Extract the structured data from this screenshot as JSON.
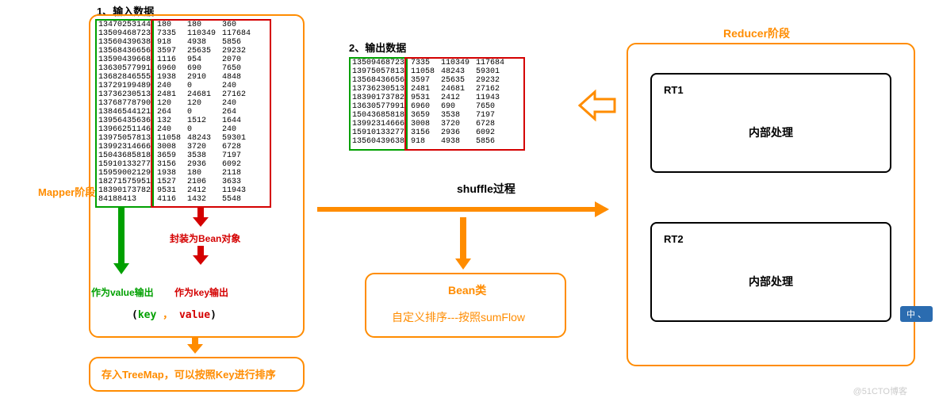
{
  "labels": {
    "input_title": "1、输入数据",
    "output_title": "2、输出数据",
    "mapper": "Mapper阶段",
    "reducer": "Reducer阶段",
    "shuffle": "shuffle过程",
    "bean_wrap": "封装为Bean对象",
    "as_value": "作为value输出",
    "as_key": "作为key输出",
    "bean_class": "Bean类",
    "bean_sort": "自定义排序---按照sumFlow",
    "treemap": "存入TreeMap，可以按照Key进行排序",
    "rt1": "RT1",
    "rt2": "RT2",
    "internal": "内部处理",
    "key": "key",
    "comma": "，",
    "value": "value",
    "ime": "中 、",
    "watermark": "@51CTO博客"
  },
  "input_data": [
    [
      "13470253144",
      "180",
      "180",
      "360"
    ],
    [
      "13509468723",
      "7335",
      "110349",
      "117684"
    ],
    [
      "13560439638",
      "918",
      "4938",
      "5856"
    ],
    [
      "13568436656",
      "3597",
      "25635",
      "29232"
    ],
    [
      "13590439668",
      "1116",
      "954",
      "2070"
    ],
    [
      "13630577991",
      "6960",
      "690",
      "7650"
    ],
    [
      "13682846555",
      "1938",
      "2910",
      "4848"
    ],
    [
      "13729199489",
      "240",
      "0",
      "240"
    ],
    [
      "13736230513",
      "2481",
      "24681",
      "27162"
    ],
    [
      "13768778790",
      "120",
      "120",
      "240"
    ],
    [
      "13846544121",
      "264",
      "0",
      "264"
    ],
    [
      "13956435636",
      "132",
      "1512",
      "1644"
    ],
    [
      "13966251146",
      "240",
      "0",
      "240"
    ],
    [
      "13975057813",
      "11058",
      "48243",
      "59301"
    ],
    [
      "13992314666",
      "3008",
      "3720",
      "6728"
    ],
    [
      "15043685818",
      "3659",
      "3538",
      "7197"
    ],
    [
      "15910133277",
      "3156",
      "2936",
      "6092"
    ],
    [
      "15959002129",
      "1938",
      "180",
      "2118"
    ],
    [
      "18271575951",
      "1527",
      "2106",
      "3633"
    ],
    [
      "18390173782",
      "9531",
      "2412",
      "11943"
    ],
    [
      "84188413",
      "4116",
      "1432",
      "5548"
    ]
  ],
  "output_data": [
    [
      "13509468723",
      "7335",
      "110349",
      "117684"
    ],
    [
      "13975057813",
      "11058",
      "48243",
      "59301"
    ],
    [
      "13568436656",
      "3597",
      "25635",
      "29232"
    ],
    [
      "13736230513",
      "2481",
      "24681",
      "27162"
    ],
    [
      "18390173782",
      "9531",
      "2412",
      "11943"
    ],
    [
      "13630577991",
      "6960",
      "690",
      "7650"
    ],
    [
      "15043685818",
      "3659",
      "3538",
      "7197"
    ],
    [
      "13992314666",
      "3008",
      "3720",
      "6728"
    ],
    [
      "15910133277",
      "3156",
      "2936",
      "6092"
    ],
    [
      "13560439638",
      "918",
      "4938",
      "5856"
    ]
  ]
}
